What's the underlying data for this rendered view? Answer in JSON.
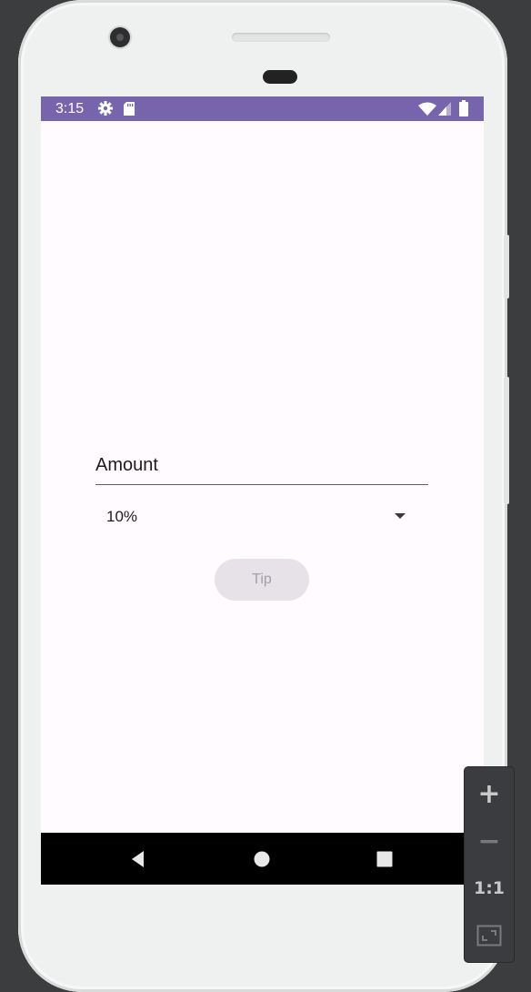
{
  "status_bar": {
    "time": "3:15",
    "left_icons": [
      "gear-icon",
      "sd-card-icon"
    ],
    "right_icons": [
      "wifi-icon",
      "cell-signal-icon",
      "battery-icon"
    ],
    "color": "#7665ac"
  },
  "form": {
    "amount_placeholder": "Amount",
    "amount_value": "",
    "tip_percent_selected": "10%",
    "tip_button_label": "Tip",
    "tip_button_enabled": false
  },
  "nav_bar": {
    "buttons": [
      "back-icon",
      "home-icon",
      "recents-icon"
    ]
  },
  "emulator_zoom": {
    "zoom_in": "+",
    "zoom_out": "−",
    "actual_size": "1:1",
    "fit_icon": "fit-screen-icon"
  }
}
